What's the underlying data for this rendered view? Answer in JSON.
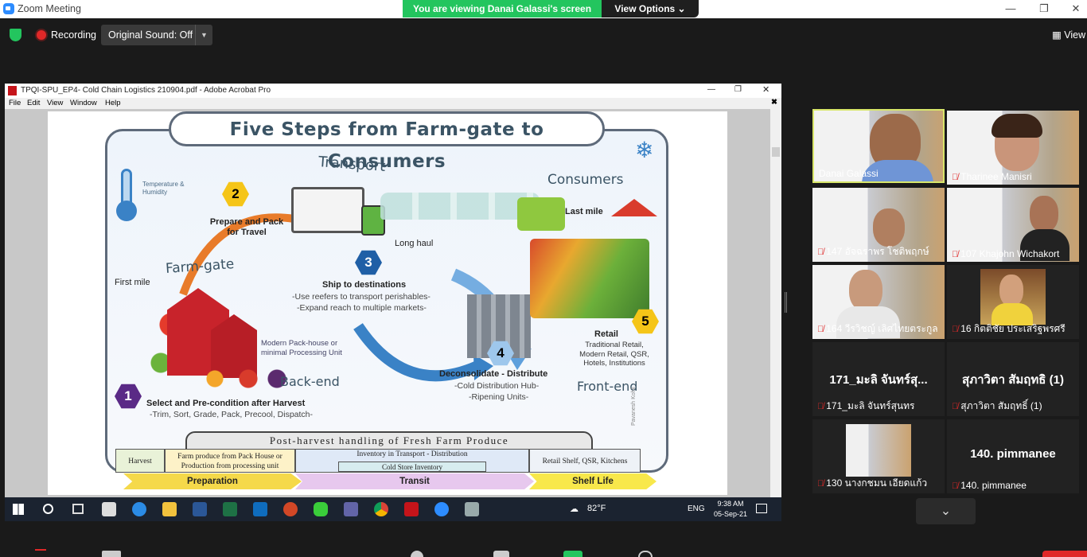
{
  "window": {
    "title": "Zoom Meeting"
  },
  "banner": {
    "viewing": "You are viewing Danai Galassi's screen",
    "view_options": "View Options ⌄"
  },
  "toolbar": {
    "recording": "Recording",
    "sound": "Original Sound: Off",
    "view": "View"
  },
  "acrobat": {
    "title": "TPQI-SPU_EP4- Cold Chain Logistics 210904.pdf - Adobe Acrobat Pro",
    "menu": [
      "File",
      "Edit",
      "View",
      "Window",
      "Help"
    ]
  },
  "slide": {
    "title": "Five Steps from Farm-gate to Consumers",
    "temp_humidity": "Temperature & Humidity",
    "transport": "Transport",
    "consumers": "Consumers",
    "farmgate": "Farm-gate",
    "first_mile": "First mile",
    "last_mile": "Last mile",
    "long_haul": "Long haul",
    "step2": "Prepare and Pack for Travel",
    "step3_title": "Ship to destinations",
    "step3_l1": "-Use reefers to transport perishables-",
    "step3_l2": "-Expand reach to multiple markets-",
    "packhouse": "Modern Pack-house or minimal Processing Unit",
    "backend": "Back-end",
    "frontend": "Front-end",
    "step1_title": "Select and Pre-condition after Harvest",
    "step1_sub": "-Trim, Sort, Grade, Pack, Precool, Dispatch-",
    "step4_title": "Deconsolidate - Distribute",
    "step4_l1": "-Cold Distribution Hub-",
    "step4_l2": "-Ripening Units-",
    "step5_title": "Retail",
    "step5_sub": "Traditional Retail, Modern Retail, QSR, Hotels, Institutions",
    "credit": "Pavanesh Kohli",
    "n1": "1",
    "n2": "2",
    "n3": "3",
    "n4": "4",
    "n5": "5",
    "postharvest": "Post-harvest handling of Fresh Farm Produce",
    "harvest": "Harvest",
    "farm_produce": "Farm produce from Pack House or Production from processing unit",
    "inventory_transport": "Inventory in Transport - Distribution",
    "cold_store": "Cold Store Inventory",
    "retail_shelf": "Retail Shelf, QSR, Kitchens",
    "prep": "Preparation",
    "transit": "Transit",
    "shelf_life": "Shelf Life"
  },
  "taskbar": {
    "temp": "82°F",
    "lang": "ENG",
    "time": "9:38 AM",
    "date": "05-Sep-21"
  },
  "participants": [
    {
      "name": "Danai Galassi"
    },
    {
      "name": "Tharinee Manisri"
    },
    {
      "name": "147 อัจฉราพร  โชติพฤกษ์"
    },
    {
      "name": "107 Khajohn Wichakort"
    },
    {
      "name": "164 วีรวิชญ์ เลิศไทยตระกูล"
    },
    {
      "name": "16 กิตติชัย ประเสริฐพรศรี"
    },
    {
      "big": "171_มะลิ จันทร์สุ...",
      "name": "171_มะลิ จันทร์สุนทร"
    },
    {
      "big": "สุภาวิตา สัมฤทธิ (1)",
      "name": "สุภาวิตา สัมฤทธิ์ (1)"
    },
    {
      "name": "130 นางกชมน เอียดแก้ว"
    },
    {
      "big": "140. pimmanee",
      "name": "140. pimmanee"
    }
  ],
  "colors": {
    "banner_green": "#23c55e",
    "zoom_blue": "#2d8cff",
    "active_border": "#d8e66a"
  },
  "icons": [
    "shield-icon",
    "record-icon",
    "chevron-down-icon",
    "grid-icon",
    "minimize-icon",
    "maximize-icon",
    "close-icon",
    "snowflake-icon",
    "thermometer-icon",
    "mic-muted-icon",
    "windows-icon",
    "search-icon"
  ]
}
